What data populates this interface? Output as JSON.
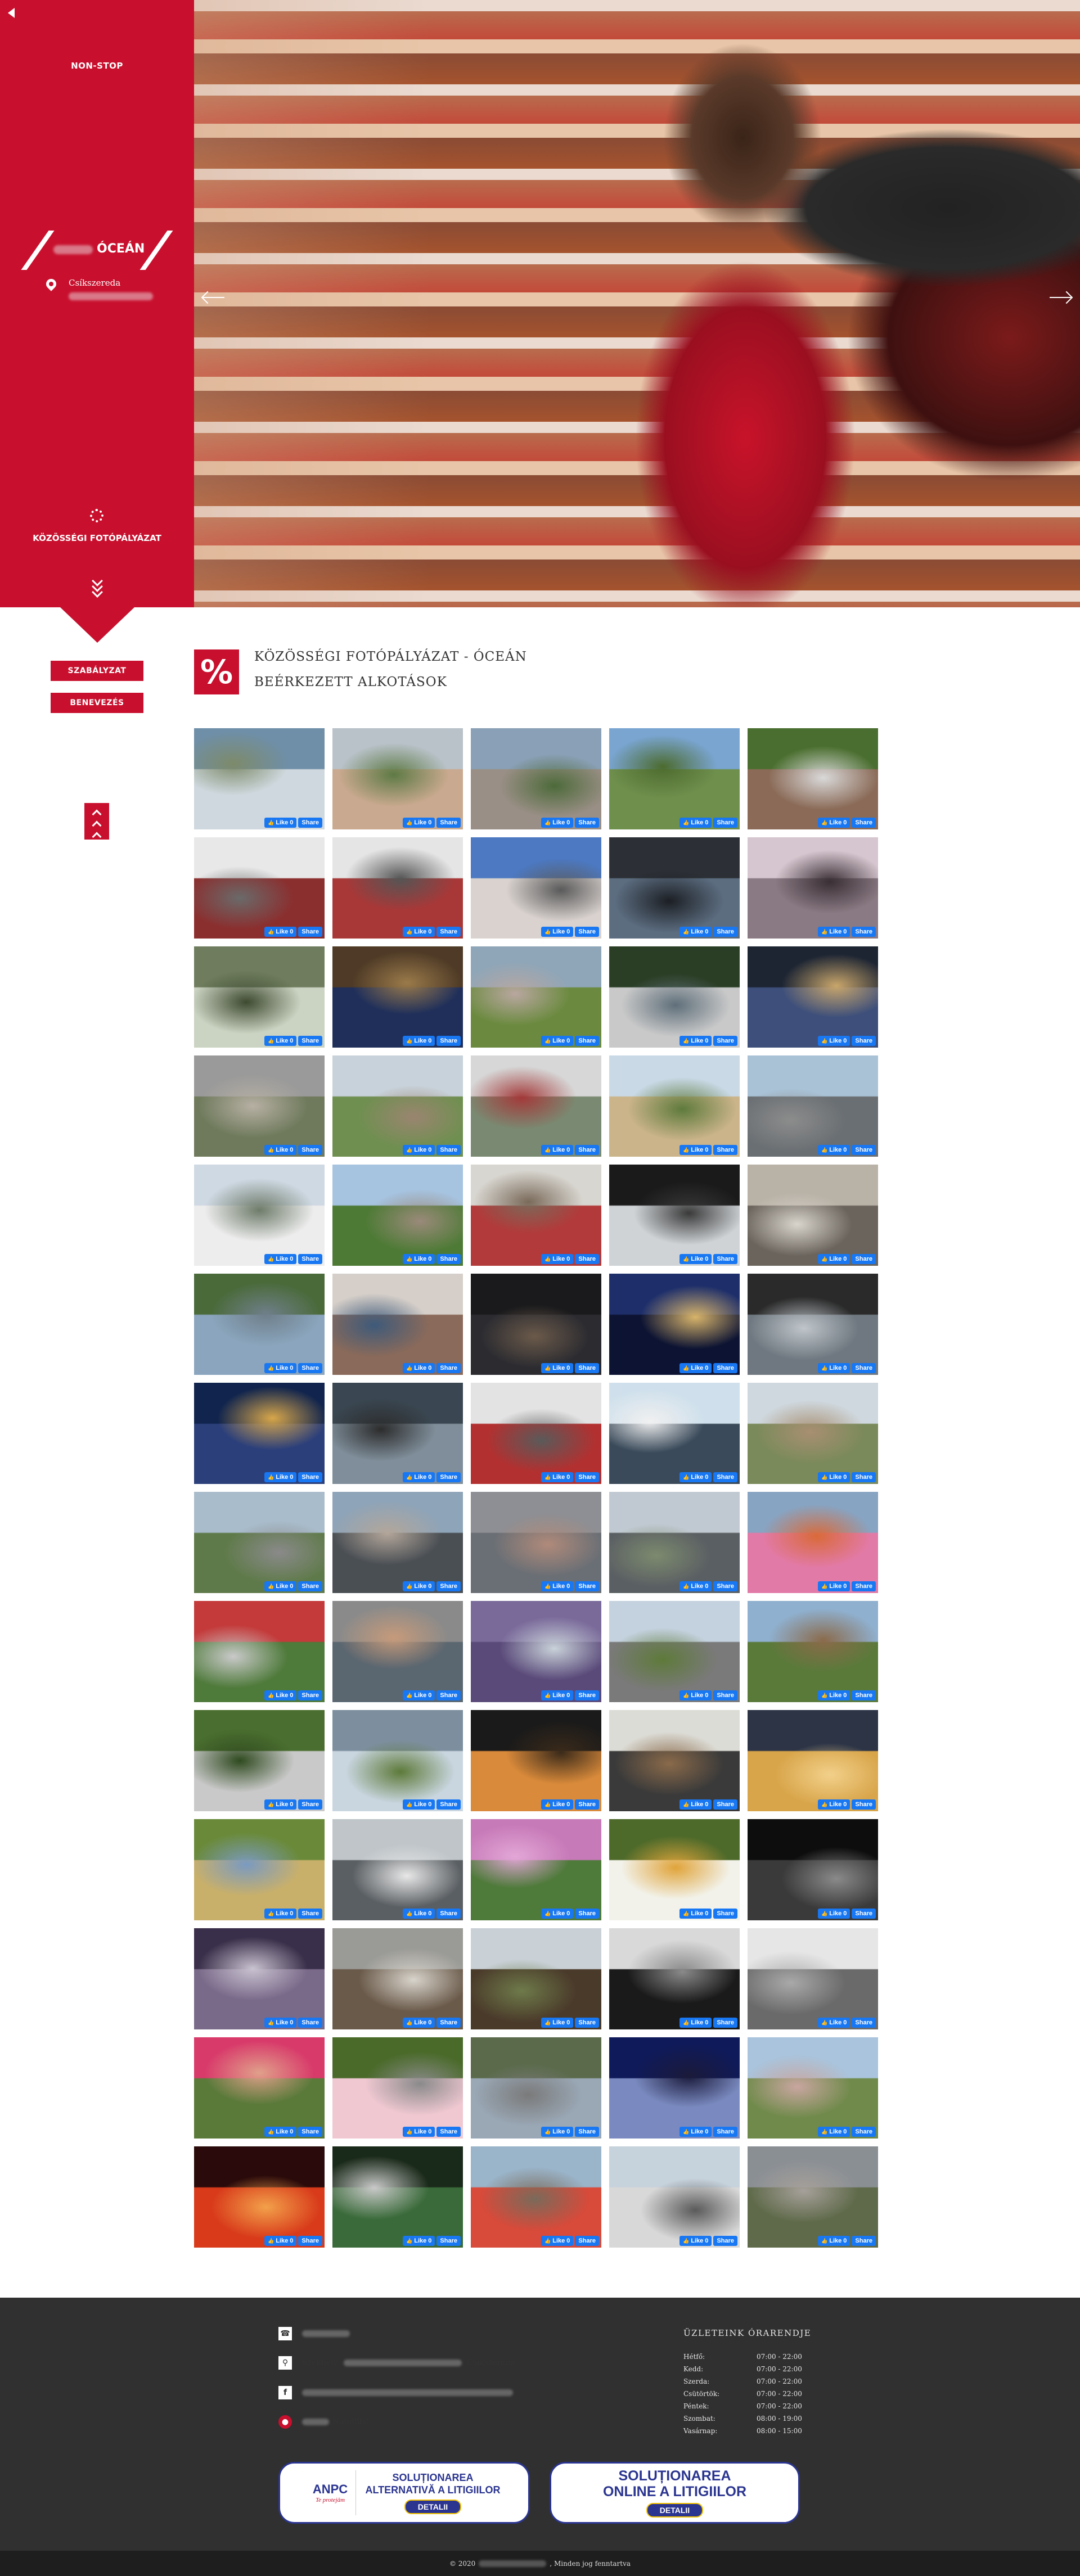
{
  "sidebar": {
    "nonstop": "NON-STOP",
    "logo_text": "ÓCEÁN",
    "city": "Csíkszereda",
    "contest_label": "KÖZÖSSÉGI FOTÓPÁLYÁZAT"
  },
  "buttons": {
    "rules": "SZABÁLYZAT",
    "entry": "BENEVEZÉS"
  },
  "page": {
    "percent_icon": "%",
    "title": "KÖZÖSSÉGI FOTÓPÁLYÁZAT - ÓCEÁN",
    "subtitle": "BEÉRKEZETT ALKOTÁSOK"
  },
  "facebook": {
    "like": "Like 0",
    "share": "Share"
  },
  "photo_palettes": [
    [
      "#6f8fa8",
      "#cfd8de",
      "#7d8a6a"
    ],
    [
      "#b9c2c9",
      "#c9a98f",
      "#5e7a45"
    ],
    [
      "#8aa0b6",
      "#9a8f86",
      "#4d6a3a"
    ],
    [
      "#7aa5d1",
      "#6f8f4d",
      "#4c6b2e"
    ],
    [
      "#4a6e2f",
      "#8b6b58",
      "#d9d9d9"
    ],
    [
      "#e8e8e8",
      "#8b2e2e",
      "#6a6a6a"
    ],
    [
      "#e5e5e5",
      "#a83838",
      "#555555"
    ],
    [
      "#4c79c2",
      "#d9d2cf",
      "#5a5a5a"
    ],
    [
      "#2c3036",
      "#5c6d80",
      "#1c1f24"
    ],
    [
      "#d6c6cf",
      "#8a7a83",
      "#3a2f35"
    ],
    [
      "#6f7d5e",
      "#cbd3c2",
      "#3e4a30"
    ],
    [
      "#4e3a26",
      "#1f2f5a",
      "#9a7a4a"
    ],
    [
      "#8fa6b8",
      "#6b8a3f",
      "#b9a7a0"
    ],
    [
      "#2a3e25",
      "#c9c9c9",
      "#5f6f7a"
    ],
    [
      "#1d2533",
      "#3d4f7a",
      "#c9a66b"
    ],
    [
      "#9a9a9a",
      "#6f7a5c",
      "#b7b0a4"
    ],
    [
      "#c8d2da",
      "#6f8f50",
      "#9a8570"
    ],
    [
      "#d7d7d7",
      "#7a8a72",
      "#a33a3a"
    ],
    [
      "#c9d9e6",
      "#cbb48a",
      "#5e7a3c"
    ],
    [
      "#a9c2d6",
      "#6a6f73",
      "#8c8c8c"
    ],
    [
      "#cfd9e3",
      "#ededed",
      "#6e7b6a"
    ],
    [
      "#a6c3e0",
      "#4d7a35",
      "#9a8a7a"
    ],
    [
      "#d8d6d0",
      "#b23a3a",
      "#7a6a5a"
    ],
    [
      "#1a1a1a",
      "#cfd3d6",
      "#3a3a3a"
    ],
    [
      "#b9b2a7",
      "#6a645d",
      "#d9d4cc"
    ],
    [
      "#4a6a3a",
      "#8aa5bd",
      "#6f7f8a"
    ],
    [
      "#d6cfc9",
      "#8a6a5a",
      "#3e5a7a"
    ],
    [
      "#1a1a1c",
      "#2b2b30",
      "#6b5a4a"
    ],
    [
      "#1d2e6a",
      "#0d1433",
      "#d8b46a"
    ],
    [
      "#2a2a2a",
      "#6f7880",
      "#bfc5ca"
    ],
    [
      "#10244d",
      "#2b3f7a",
      "#d7a64a"
    ],
    [
      "#3a4752",
      "#7f8e9a",
      "#2c2c2c"
    ],
    [
      "#e3e3e3",
      "#b33030",
      "#5a5a5a"
    ],
    [
      "#cfe0ec",
      "#3a4a5a",
      "#f0f0f0"
    ],
    [
      "#cfd8de",
      "#7a8a5a",
      "#a88f72"
    ],
    [
      "#a9bccb",
      "#5f7a4a",
      "#8a8a8a"
    ],
    [
      "#8ea4b8",
      "#4a4f54",
      "#b3a69a"
    ],
    [
      "#8d8f94",
      "#6a6f75",
      "#b08a7a"
    ],
    [
      "#c0c9d1",
      "#5a5f63",
      "#7d8a6e"
    ],
    [
      "#87a4c2",
      "#e27aa8",
      "#d96a3a"
    ],
    [
      "#c43a3a",
      "#4e7a3a",
      "#c9c9c9"
    ],
    [
      "#8a8a8a",
      "#5a6670",
      "#c69a7a"
    ],
    [
      "#7a6a9a",
      "#5a4a7a",
      "#c9d2d9"
    ],
    [
      "#c4d2df",
      "#7a7a7a",
      "#5e7a3a"
    ],
    [
      "#8fb0cf",
      "#5a7a3a",
      "#8a6a4a"
    ],
    [
      "#4a6e2f",
      "#c9c9c9",
      "#2f4a1f"
    ],
    [
      "#7d8f9e",
      "#c9d6e0",
      "#5e7a3a"
    ],
    [
      "#1a1a1a",
      "#d98a3a",
      "#3a2a1a"
    ],
    [
      "#dcdcd6",
      "#3a3a3a",
      "#8a6a4a"
    ],
    [
      "#2c3446",
      "#d8a54a",
      "#f2d08a"
    ],
    [
      "#6a8a3a",
      "#c9b06a",
      "#7a9ac0"
    ],
    [
      "#bfc5c9",
      "#5a5f63",
      "#e8e8e8"
    ],
    [
      "#c77ab8",
      "#4e7a3a",
      "#e2a6d6"
    ],
    [
      "#4e6a2a",
      "#f2f2ea",
      "#e0a43a"
    ],
    [
      "#0d0d0d",
      "#3a3a3a",
      "#8a8a8a"
    ],
    [
      "#3a2f4a",
      "#7a6a8a",
      "#c9c2d0"
    ],
    [
      "#9a9a96",
      "#6a5a4a",
      "#d8d4cc"
    ],
    [
      "#c9d1d7",
      "#4a3a2a",
      "#6e7a4a"
    ],
    [
      "#d9d9d9",
      "#1a1a1a",
      "#8a8a8a"
    ],
    [
      "#e6e6e6",
      "#6a6a6a",
      "#a9a9a9"
    ],
    [
      "#d83a6a",
      "#5a7a3a",
      "#e0a08a"
    ],
    [
      "#4a6a2a",
      "#f0c8d2",
      "#8a8a8a"
    ],
    [
      "#5a6a4a",
      "#9aa8b6",
      "#7a7a7a"
    ],
    [
      "#0f1a5a",
      "#7a8ac0",
      "#1a1a3a"
    ],
    [
      "#a9c4dc",
      "#6f8a4a",
      "#c9a6a0"
    ],
    [
      "#2a0a0a",
      "#d83a1a",
      "#f2a04a"
    ],
    [
      "#1a2a1a",
      "#3a6a3a",
      "#c9c9c9"
    ],
    [
      "#9ab4c9",
      "#d84a3a",
      "#7a6a5a"
    ],
    [
      "#c6d2dc",
      "#d8d8d8",
      "#5a5a5a"
    ],
    [
      "#8a8f94",
      "#5f6a4a",
      "#a6a09a"
    ]
  ],
  "footer": {
    "office_label": "Székhely:",
    "office_city": ", Csíkszereda",
    "brand_suffix": "Nandfüst",
    "hours_title": "ÜZLETEINK ÓRARENDJE",
    "hours": [
      {
        "day": "Hétfő:",
        "time": "07:00 - 22:00"
      },
      {
        "day": "Kedd:",
        "time": "07:00 - 22:00"
      },
      {
        "day": "Szerda:",
        "time": "07:00 - 22:00"
      },
      {
        "day": "Csütörtök:",
        "time": "07:00 - 22:00"
      },
      {
        "day": "Péntek:",
        "time": "07:00 - 22:00"
      },
      {
        "day": "Szombat:",
        "time": "08:00 - 19:00"
      },
      {
        "day": "Vasárnap:",
        "time": "08:00 - 15:00"
      }
    ],
    "anpc": {
      "logo": "ANPC",
      "tagline": "Te protejăm",
      "text": "SOLUȚIONAREA ALTERNATIVĂ A LITIGIILOR",
      "details": "DETALII"
    },
    "online": {
      "text": "SOLUȚIONAREA ONLINE A LITIGIILOR",
      "details": "DETALII"
    },
    "copyright_prefix": "© 2020",
    "copyright_suffix": ", Minden jog fenntartva"
  }
}
